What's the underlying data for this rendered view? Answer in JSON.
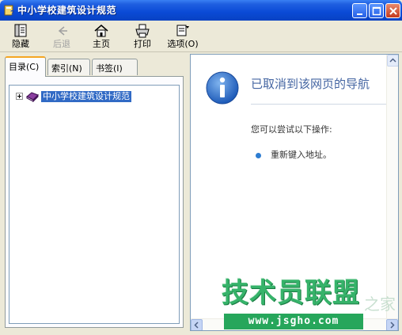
{
  "window": {
    "title": "中小学校建筑设计规范"
  },
  "toolbar": {
    "hide_label": "隐藏",
    "back_label": "后退",
    "home_label": "主页",
    "print_label": "打印",
    "options_label": "选项(O)"
  },
  "tabs": [
    {
      "label": "目录(C)",
      "active": true
    },
    {
      "label": "索引(N)",
      "active": false
    },
    {
      "label": "书签(I)",
      "active": false
    }
  ],
  "tree": {
    "items": [
      {
        "label": "中小学校建筑设计规范",
        "selected": true
      }
    ]
  },
  "content": {
    "title": "已取消到该网页的导航",
    "hint": "您可以尝试以下操作:",
    "actions": [
      "重新键入地址。"
    ]
  },
  "watermark": {
    "brand": "技术员联盟",
    "url": "www.jsgho.com",
    "side": "之家"
  },
  "colors": {
    "titlebar": "#0a4ad6",
    "selection": "#316ac5",
    "nav_title": "#4465a2",
    "watermark": "#36b36a"
  }
}
